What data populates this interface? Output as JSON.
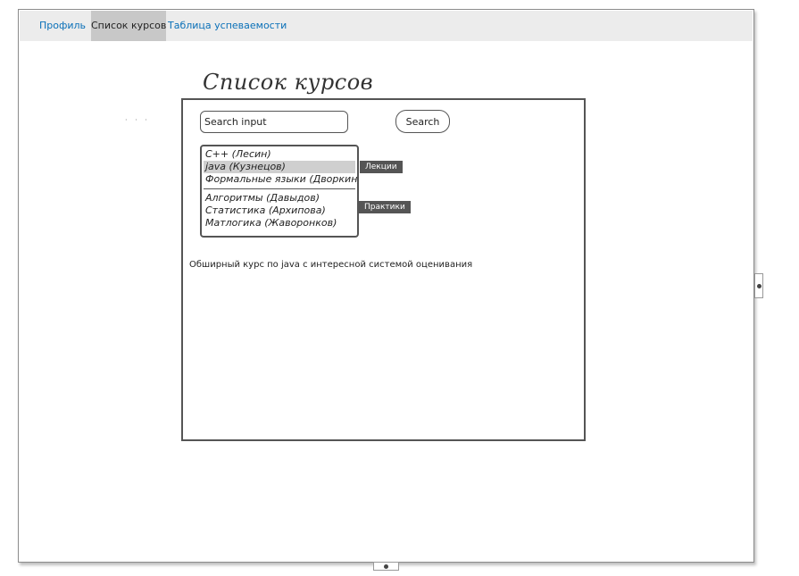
{
  "nav": {
    "tabs": [
      {
        "label": "Профиль",
        "active": false
      },
      {
        "label": "Список курсов",
        "active": true
      },
      {
        "label": "Таблица успеваемости",
        "active": false
      }
    ]
  },
  "page": {
    "title": "Список курсов"
  },
  "search": {
    "value": "Search input",
    "button_label": "Search"
  },
  "courses": {
    "lectures": [
      {
        "label": "C++ (Лесин)",
        "selected": false
      },
      {
        "label": "java (Кузнецов)",
        "selected": true
      },
      {
        "label": "Формальные языки (Дворкин)",
        "selected": false
      }
    ],
    "practices": [
      {
        "label": "Алгоритмы (Давыдов)",
        "selected": false
      },
      {
        "label": "Статистика (Архипова)",
        "selected": false
      },
      {
        "label": "Матлогика (Жаворонков)",
        "selected": false
      }
    ],
    "lectures_tag": "Лекции",
    "practices_tag": "Практики"
  },
  "description": "Обширный курс по java с интересной системой оценивания",
  "colors": {
    "link": "#0a70b8",
    "active_tab_bg": "#c8c8c8",
    "tag_bg": "#555555",
    "selection_bg": "#cfcfcf"
  }
}
